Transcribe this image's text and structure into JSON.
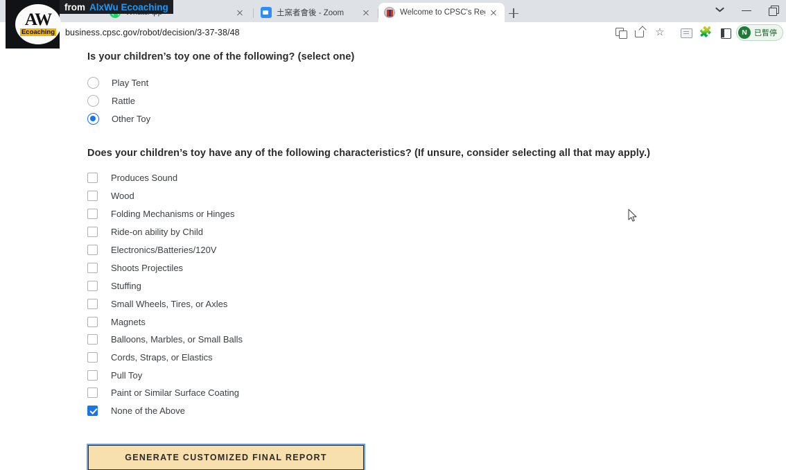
{
  "browser": {
    "tabs": [
      {
        "title": "WhatsApp",
        "favicon": "whatsapp-icon",
        "active": false
      },
      {
        "title": "土窯者會後 - Zoom",
        "favicon": "zoom-icon",
        "active": false
      },
      {
        "title": "Welcome to CPSC's Regulatory R",
        "favicon": "cpsc-seal-icon",
        "active": true
      }
    ],
    "new_tab_label": "+",
    "window_controls": [
      "chevron-down",
      "minimize",
      "restore"
    ],
    "url": "business.cpsc.gov/robot/decision/3-37-38/48",
    "security_icon": "lock-icon",
    "toolbar_icons": [
      "translate-icon",
      "share-icon",
      "bookmark-star-icon",
      "extension-note-icon",
      "extensions-puzzle-icon",
      "side-panel-icon"
    ],
    "star_glyph": "☆",
    "puzzle_glyph": "🧩",
    "profile": {
      "avatar_initial": "N",
      "status_label": "已暫停",
      "accent": "#1e7a36"
    }
  },
  "watermark": {
    "logo_primary": "AW",
    "logo_secondary": "Ecoaching",
    "banner_prefix": "from",
    "banner_brand": "AlxWu Ecoaching",
    "brand_color": "#2196f3",
    "highlight_color": "#f5b301"
  },
  "page": {
    "question1": {
      "heading": "Is your children’s toy one of the following? (select one)",
      "type": "radio",
      "options": [
        {
          "label": "Play Tent",
          "selected": false
        },
        {
          "label": "Rattle",
          "selected": false
        },
        {
          "label": "Other Toy",
          "selected": true
        }
      ]
    },
    "question2": {
      "heading": "Does your children’s toy have any of the following characteristics? (If unsure, consider selecting all that may apply.)",
      "type": "checkbox",
      "options": [
        {
          "label": "Produces Sound",
          "checked": false
        },
        {
          "label": "Wood",
          "checked": false
        },
        {
          "label": "Folding Mechanisms or Hinges",
          "checked": false
        },
        {
          "label": "Ride-on ability by Child",
          "checked": false
        },
        {
          "label": "Electronics/Batteries/120V",
          "checked": false
        },
        {
          "label": "Shoots Projectiles",
          "checked": false
        },
        {
          "label": "Stuffing",
          "checked": false
        },
        {
          "label": "Small Wheels, Tires, or Axles",
          "checked": false
        },
        {
          "label": "Magnets",
          "checked": false
        },
        {
          "label": "Balloons, Marbles, or Small Balls",
          "checked": false
        },
        {
          "label": "Cords, Straps, or Elastics",
          "checked": false
        },
        {
          "label": "Pull Toy",
          "checked": false
        },
        {
          "label": "Paint or Similar Surface Coating",
          "checked": false
        },
        {
          "label": "None of the Above",
          "checked": true
        }
      ]
    },
    "submit_button": {
      "label": "GENERATE CUSTOMIZED FINAL REPORT",
      "fill": "#f8dfae",
      "focus_ring": "#6a9fe0"
    },
    "accent_color": "#1a73e8"
  }
}
